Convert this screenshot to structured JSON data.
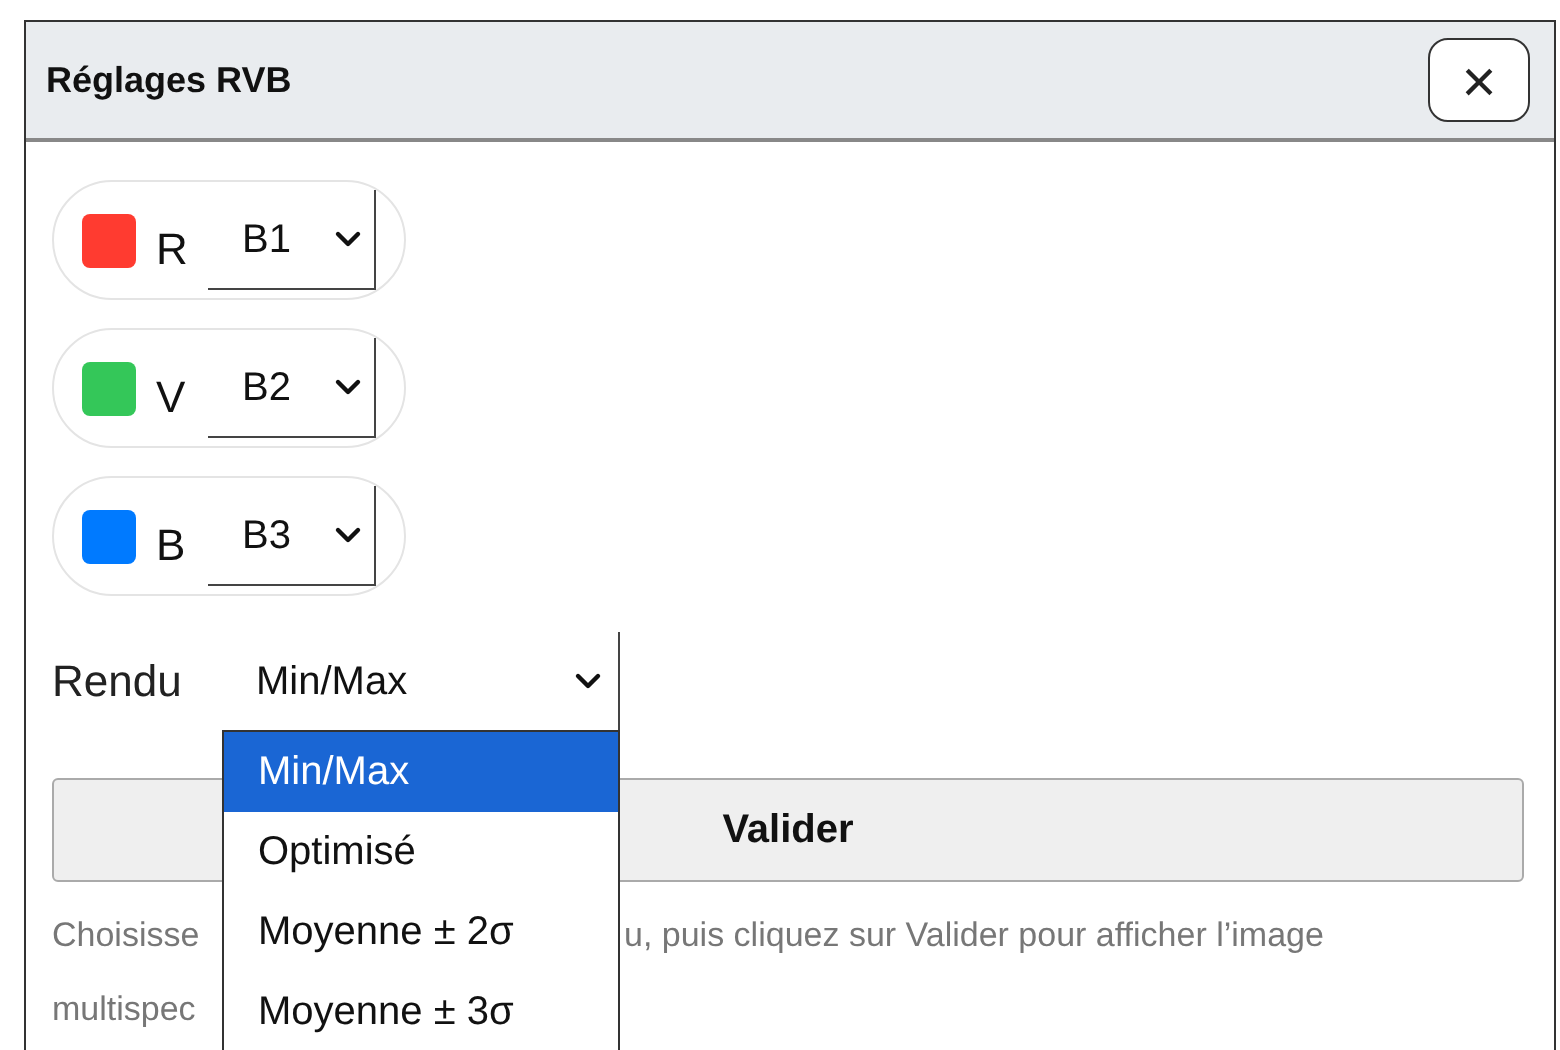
{
  "dialog": {
    "title": "Réglages RVB",
    "close": "×"
  },
  "channels": [
    {
      "letter": "R",
      "color": "#ff3b30",
      "band": "B1"
    },
    {
      "letter": "V",
      "color": "#34c759",
      "band": "B2"
    },
    {
      "letter": "B",
      "color": "#007aff",
      "band": "B3"
    }
  ],
  "render": {
    "label": "Rendu",
    "value": "Min/Max",
    "expanded": true,
    "options": [
      {
        "label": "Min/Max",
        "selected": true
      },
      {
        "label": "Optimisé",
        "selected": false
      },
      {
        "label": "Moyenne ± 2σ",
        "selected": false
      },
      {
        "label": "Moyenne ± 3σ",
        "selected": false
      }
    ]
  },
  "submit": "Valider",
  "help": {
    "line_1_start": "Choisisse",
    "line_1_end": "u, puis cliquez sur Valider pour afficher l’image",
    "line_2_start": "multispec"
  }
}
